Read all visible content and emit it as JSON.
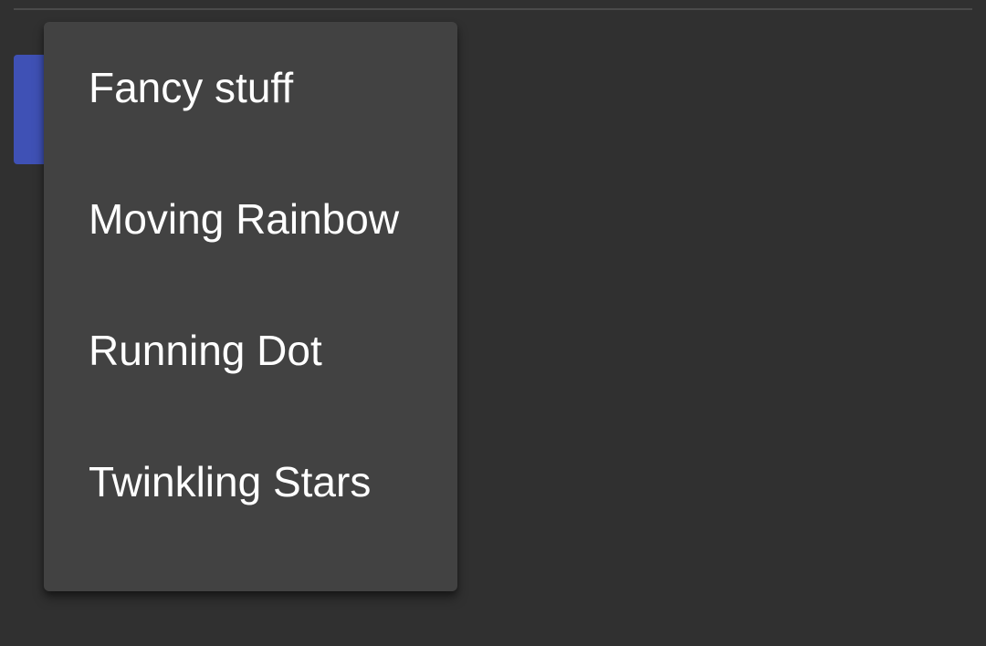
{
  "colors": {
    "background": "#303030",
    "menu_surface": "#424242",
    "accent_button": "#3f51b5",
    "text": "#ffffff"
  },
  "menu": {
    "items": [
      {
        "label": "Fancy stuff"
      },
      {
        "label": "Moving Rainbow"
      },
      {
        "label": "Running Dot"
      },
      {
        "label": "Twinkling Stars"
      }
    ]
  }
}
